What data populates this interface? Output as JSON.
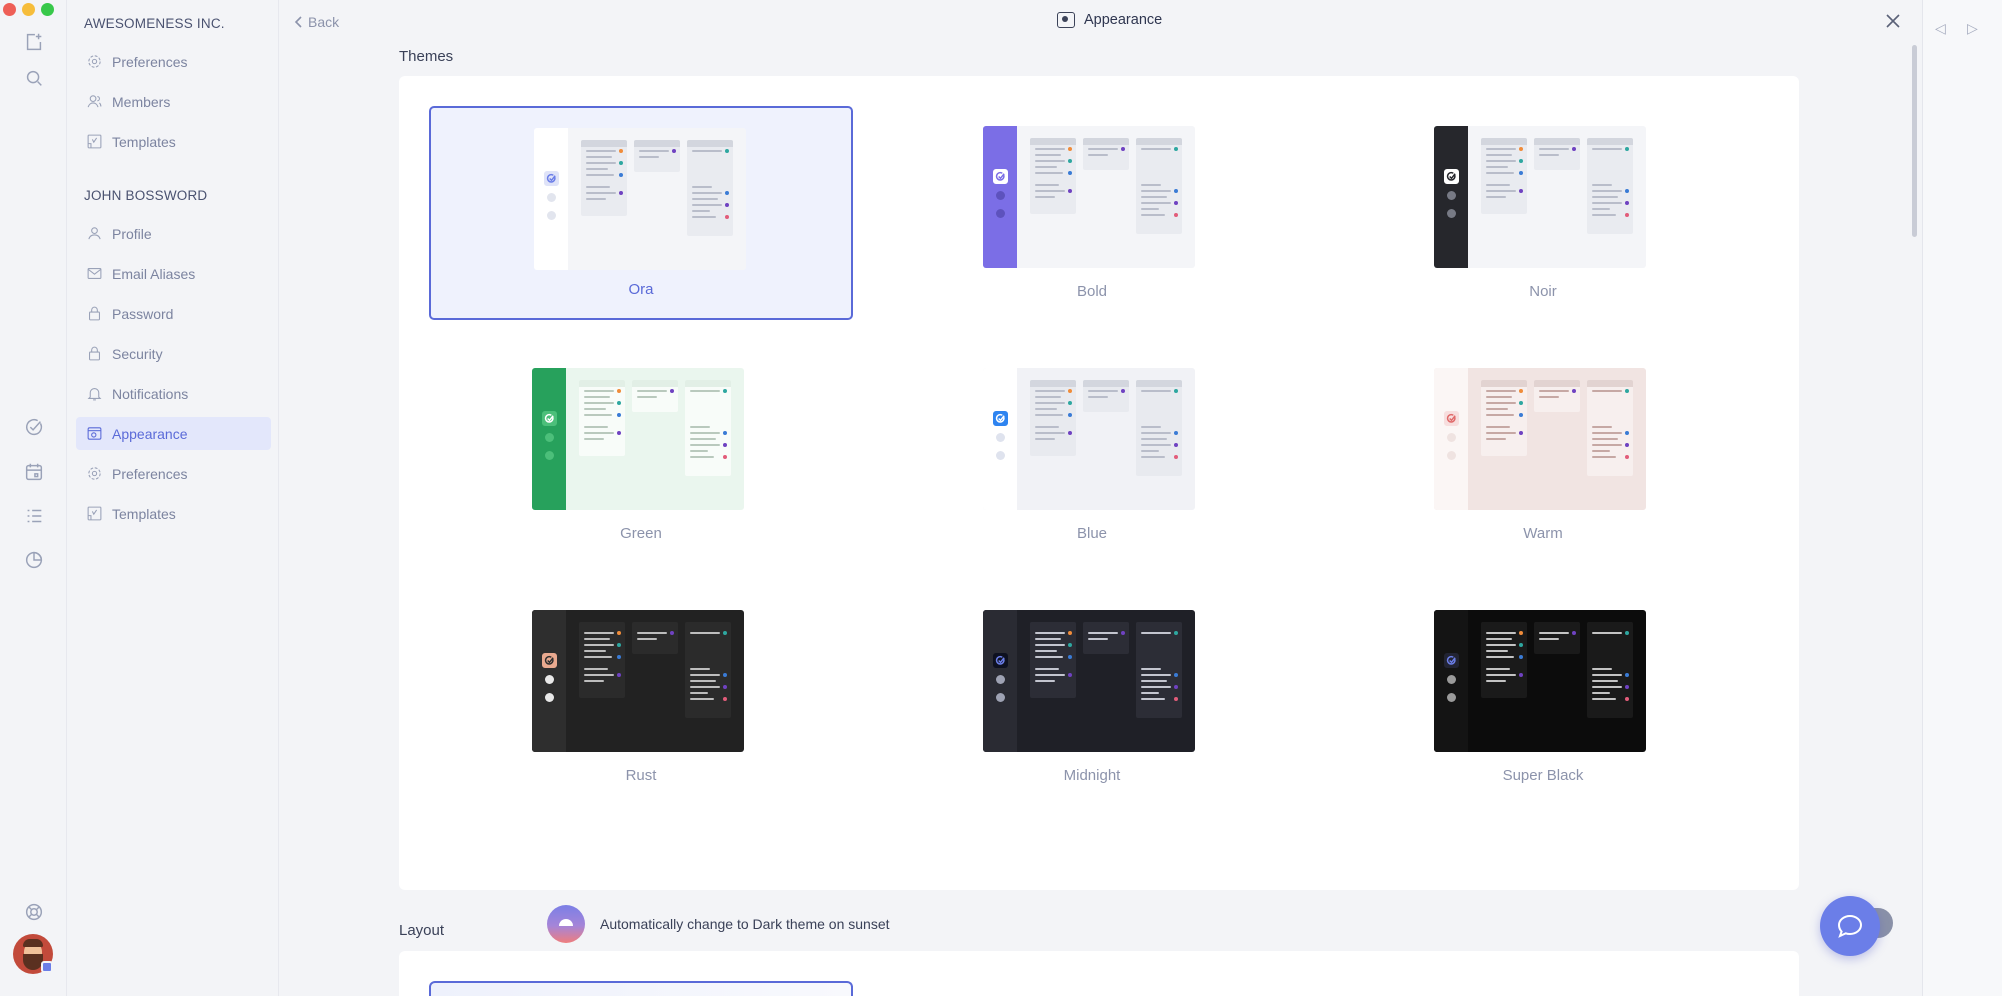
{
  "window": {
    "traffic_colors": [
      "#ee5f57",
      "#f6bd3b",
      "#38c84a"
    ]
  },
  "rail": {
    "icons": [
      "new-note-icon",
      "search-icon",
      "tasks-check-icon",
      "calendar-icon",
      "list-icon",
      "stats-icon",
      "help-lifebuoy-icon"
    ]
  },
  "sidebar": {
    "org_heading": "AWESOMENESS INC.",
    "org_items": [
      {
        "label": "Preferences",
        "icon": "gear-icon"
      },
      {
        "label": "Members",
        "icon": "members-icon"
      },
      {
        "label": "Templates",
        "icon": "templates-icon"
      }
    ],
    "user_heading": "JOHN BOSSWORD",
    "user_items": [
      {
        "label": "Profile",
        "icon": "user-icon"
      },
      {
        "label": "Email Aliases",
        "icon": "mail-icon"
      },
      {
        "label": "Password",
        "icon": "lock-icon"
      },
      {
        "label": "Security",
        "icon": "lock-icon"
      },
      {
        "label": "Notifications",
        "icon": "bell-icon"
      },
      {
        "label": "Appearance",
        "icon": "appearance-icon",
        "active": true
      },
      {
        "label": "Preferences",
        "icon": "gear-icon"
      },
      {
        "label": "Templates",
        "icon": "templates-icon"
      }
    ]
  },
  "header": {
    "back_label": "Back",
    "title": "Appearance"
  },
  "themes_section": {
    "label": "Themes",
    "selected": "Ora",
    "themes": [
      {
        "name": "Ora",
        "sidebar": "#ffffff",
        "bg": "#f4f5f8",
        "col": "#e9ebf0",
        "head": "#d3d6de",
        "line": "#b9bdca",
        "logo": "#dfe3f8",
        "logo_mark": "#6b7ee8",
        "dot": "#e2e5ee"
      },
      {
        "name": "Bold",
        "sidebar": "#7b6ee6",
        "bg": "#f4f5f8",
        "col": "#e9ebf0",
        "head": "#d3d6de",
        "line": "#b9bdca",
        "logo": "#ffffff",
        "logo_mark": "#7b6ee6",
        "dot": "#5d52bd"
      },
      {
        "name": "Noir",
        "sidebar": "#26272c",
        "bg": "#f4f5f8",
        "col": "#e9ebf0",
        "head": "#d3d6de",
        "line": "#b9bdca",
        "logo": "#ffffff",
        "logo_mark": "#26272c",
        "dot": "#777a85"
      },
      {
        "name": "Green",
        "sidebar": "#27a15c",
        "bg": "#eaf6ee",
        "col": "#f8fcf9",
        "head": "#e2efe6",
        "line": "#b9c9bd",
        "logo": "#4cbf7a",
        "logo_mark": "#ffffff",
        "dot": "#4cbf7a"
      },
      {
        "name": "Blue",
        "sidebar": "#ffffff",
        "bg": "#f1f2f6",
        "col": "#e8eaef",
        "head": "#d3d6de",
        "line": "#b9bdca",
        "logo": "#2e84f0",
        "logo_mark": "#ffffff",
        "dot": "#dfe3ee"
      },
      {
        "name": "Warm",
        "sidebar": "#fbf6f5",
        "bg": "#f1e4e2",
        "col": "#f7efee",
        "head": "#e2d3d1",
        "line": "#c6a8a4",
        "logo": "#f7dede",
        "logo_mark": "#e06a6a",
        "dot": "#efe3e1"
      },
      {
        "name": "Rust",
        "sidebar": "#2e2e2e",
        "bg": "#222222",
        "col": "#2b2b2b",
        "head": "#2b2b2b",
        "line": "#bdbdbd",
        "logo": "#e9a98f",
        "logo_mark": "#2e2e2e",
        "dot": "#e8e8e8"
      },
      {
        "name": "Midnight",
        "sidebar": "#2a2b33",
        "bg": "#1f2027",
        "col": "#2c2d36",
        "head": "#2c2d36",
        "line": "#c3c5cf",
        "logo": "#0e1120",
        "logo_mark": "#6b7ee8",
        "dot": "#9ea2b3"
      },
      {
        "name": "Super Black",
        "sidebar": "#141414",
        "bg": "#0c0c0c",
        "col": "#1a1a1a",
        "head": "#1a1a1a",
        "line": "#c3c3c3",
        "logo": "#222433",
        "logo_mark": "#6b7ee8",
        "dot": "#9a9a9a"
      }
    ],
    "accent_dots": [
      "#f08c3a",
      "#6f42c1",
      "#2ea7a0",
      "#e25c7a",
      "#3a7bd5"
    ]
  },
  "auto_dark": {
    "label": "Automatically change to Dark theme on sunset",
    "enabled": false
  },
  "layout_section": {
    "label": "Layout"
  },
  "accent": "#5a6ad8"
}
